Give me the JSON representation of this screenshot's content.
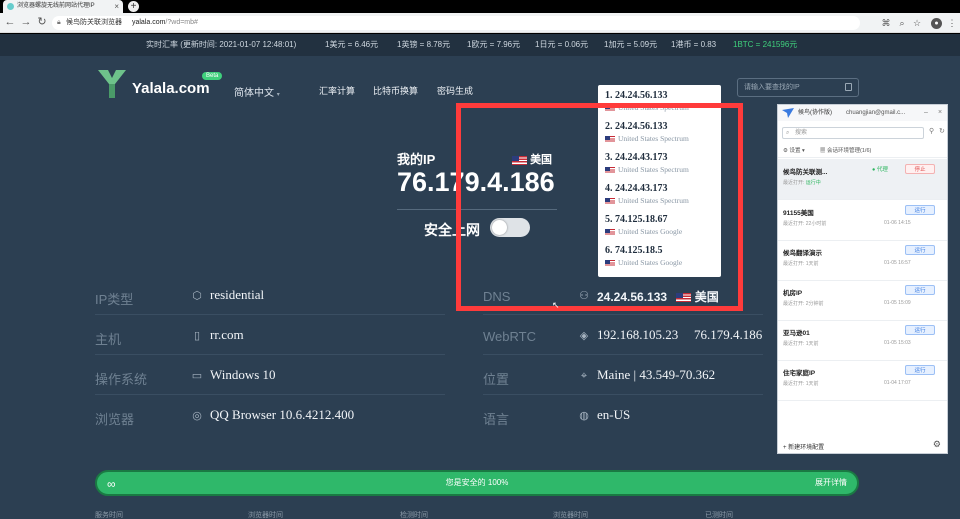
{
  "browser": {
    "tab_title": "浏览器螺旋无线前网站代理IP",
    "url_domain": "yalala.com",
    "url_path": "/?wd=mb#",
    "url_prefix": "候鸟防关联浏览器",
    "new_tab": "+",
    "tab_close": "×"
  },
  "ticker": {
    "time": "实时汇率 (更新时间: 2021-01-07 12:48:01)",
    "usd": "1美元 = 6.46元",
    "gbp": "1英镑 = 8.78元",
    "eur": "1欧元 = 7.96元",
    "jpy": "1日元 = 0.06元",
    "cad": "1加元 = 5.09元",
    "hkd": "1港币 = 0.83",
    "btc": "1BTC = 241596元"
  },
  "header": {
    "logo_text": "Yalala.com",
    "beta": "Beta",
    "lang": "简体中文",
    "nav": [
      "汇率计算",
      "比特币换算",
      "密码生成"
    ],
    "search_placeholder": "请输入要查找的IP"
  },
  "myip": {
    "label": "我的IP",
    "country": "美国",
    "value": "76.179.4.186",
    "safe_label": "安全上网"
  },
  "dns_popup": [
    {
      "ip": "1. 24.24.56.133",
      "isp": "United States Spectrum"
    },
    {
      "ip": "2. 24.24.56.133",
      "isp": "United States Spectrum"
    },
    {
      "ip": "3. 24.24.43.173",
      "isp": "United States Spectrum"
    },
    {
      "ip": "4. 24.24.43.173",
      "isp": "United States Spectrum"
    },
    {
      "ip": "5. 74.125.18.67",
      "isp": "United States Google"
    },
    {
      "ip": "6. 74.125.18.5",
      "isp": "United States Google"
    }
  ],
  "info_rows": {
    "ip_type": {
      "label": "IP类型",
      "value": "residential"
    },
    "host": {
      "label": "主机",
      "value": "rr.com"
    },
    "os": {
      "label": "操作系统",
      "value": "Windows 10"
    },
    "browser": {
      "label": "浏览器",
      "value": "QQ Browser 10.6.4212.400"
    },
    "dns": {
      "label": "DNS",
      "value": "24.24.56.133",
      "country": "美国"
    },
    "webrtc": {
      "label": "WebRTC",
      "value": "192.168.105.23",
      "value2": "76.179.4.186"
    },
    "location": {
      "label": "位置",
      "value": "Maine | 43.549-70.362"
    },
    "language": {
      "label": "语言",
      "value": "en-US"
    }
  },
  "safebar": {
    "text": "您是安全的 100%",
    "expand": "展开详情"
  },
  "bottom_labels": [
    "服务时间",
    "浏览器时间",
    "检测时间",
    "浏览器时间",
    "已测时间"
  ],
  "app": {
    "title": "候鸟(协作版)",
    "email": "chuangjian@gmail.c...",
    "search_placeholder": "搜索",
    "settings": "设置",
    "env_manage": "会话环境管理(1/6)",
    "profiles": [
      {
        "name": "候鸟防关联测...",
        "meta": "最近打开:",
        "status_text": "运行中",
        "date": "",
        "state": "代理",
        "button": "停止"
      },
      {
        "name": "91155美国",
        "meta": "最近打开: 22小时前",
        "status_text": "",
        "date": "01-06 14:15",
        "state": "",
        "button": "运行"
      },
      {
        "name": "候鸟翻译演示",
        "meta": "最近打开: 1天前",
        "status_text": "",
        "date": "01-05 16:57",
        "state": "",
        "button": "运行"
      },
      {
        "name": "机房IP",
        "meta": "最近打开: 2分钟前",
        "status_text": "",
        "date": "01-05 15:09",
        "state": "",
        "button": "运行"
      },
      {
        "name": "亚马逊01",
        "meta": "最近打开: 1天前",
        "status_text": "",
        "date": "01-05 15:03",
        "state": "",
        "button": "运行"
      },
      {
        "name": "住宅家庭IP",
        "meta": "最近打开: 1天前",
        "status_text": "",
        "date": "01-04 17:07",
        "state": "",
        "button": "运行"
      }
    ],
    "new_profile": "+ 新建环境配置"
  },
  "colors": {
    "page_bg": "#2c3f52",
    "accent_green": "#2fb86a",
    "highlight_red": "#ff3b3b"
  }
}
